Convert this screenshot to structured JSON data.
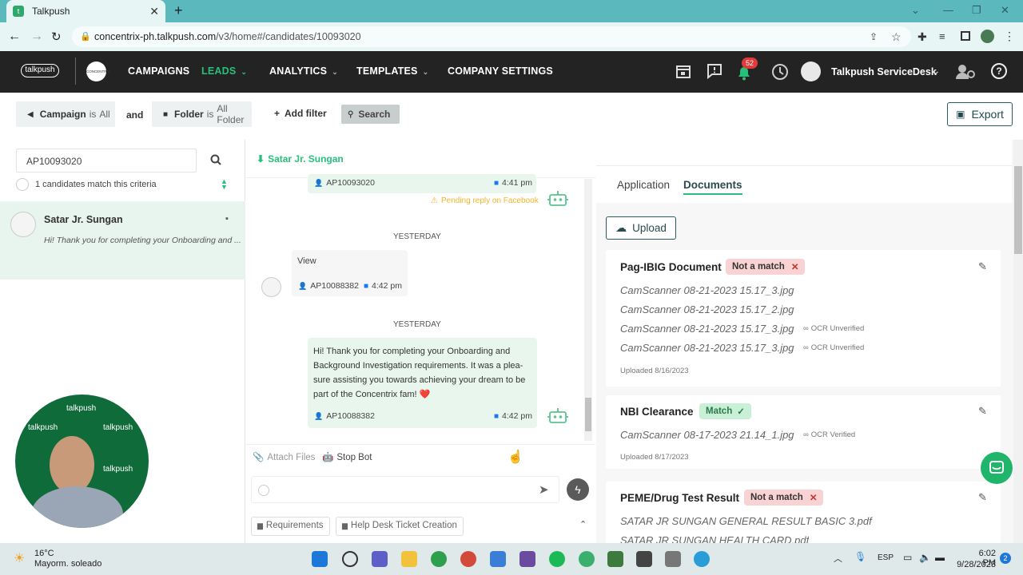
{
  "browser": {
    "tab_title": "Talkpush",
    "url_host": "concentrix-ph.talkpush.com",
    "url_path": "/v3/home#/candidates/10093020"
  },
  "header": {
    "logo_text": "talkpush",
    "client_logo": "CONCENTRIX",
    "nav": [
      "CAMPAIGNS",
      "LEADS",
      "ANALYTICS",
      "TEMPLATES",
      "COMPANY SETTINGS"
    ],
    "active_nav": "LEADS",
    "notif_count": "52",
    "user_name": "Talkpush ServiceDesk"
  },
  "filters": {
    "campaign_label": "Campaign",
    "campaign_op": "is",
    "campaign_value": "All",
    "and": "and",
    "folder_label": "Folder",
    "folder_op": "is",
    "folder_value": "All Folder",
    "add_filter": "Add filter",
    "search": "Search",
    "export": "Export"
  },
  "left": {
    "search_value": "AP10093020",
    "match_text": "1 candidates match this criteria",
    "candidate_name": "Satar Jr. Sungan",
    "candidate_preview": "Hi! Thank you for completing your Onboarding and ..."
  },
  "chat": {
    "header_name": "Satar Jr. Sungan",
    "msg1_id": "AP10093020",
    "msg1_time": "4:41 pm",
    "pending": "Pending reply on Facebook",
    "day1": "YESTERDAY",
    "msg2_text": "View",
    "msg2_id": "AP10088382",
    "msg2_time": "4:42 pm",
    "day2": "YESTERDAY",
    "msg3_line1": "Hi! Thank you for completing your Onboarding and",
    "msg3_line2": "Background Investigation requirements. It was a plea-",
    "msg3_line3": "sure assisting you towards achieving your dream to be",
    "msg3_line4": "part of the Concentrix fam! ❤️",
    "msg3_id": "AP10088382",
    "msg3_time": "4:42 pm",
    "attach": "Attach Files",
    "stop_bot": "Stop Bot",
    "requirements": "Requirements",
    "helpdesk": "Help Desk Ticket Creation"
  },
  "right": {
    "tabs": [
      "Application",
      "Documents"
    ],
    "active_tab": "Documents",
    "upload": "Upload",
    "docs": [
      {
        "title": "Pag-IBIG Document",
        "status": "Not a match",
        "files": [
          {
            "name": "CamScanner 08-21-2023 15.17_3.jpg",
            "ocr": ""
          },
          {
            "name": "CamScanner 08-21-2023 15.17_2.jpg",
            "ocr": ""
          },
          {
            "name": "CamScanner 08-21-2023 15.17_3.jpg",
            "ocr": "OCR Unverified"
          },
          {
            "name": "CamScanner 08-21-2023 15.17_3.jpg",
            "ocr": "OCR Unverified"
          }
        ],
        "uploaded": "Uploaded 8/16/2023"
      },
      {
        "title": "NBI Clearance",
        "status": "Match",
        "files": [
          {
            "name": "CamScanner 08-17-2023 21.14_1.jpg",
            "ocr": "OCR Verified"
          }
        ],
        "uploaded": "Uploaded 8/17/2023"
      },
      {
        "title": "PEME/Drug Test Result",
        "status": "Not a match",
        "files": [
          {
            "name": "SATAR JR SUNGAN   GENERAL RESULT BASIC 3.pdf",
            "ocr": ""
          },
          {
            "name": "SATAR JR SUNGAN   HEALTH CARD.pdf",
            "ocr": ""
          }
        ]
      }
    ]
  },
  "webcam": {
    "watermark": "talkpush"
  },
  "taskbar": {
    "temp": "16°C",
    "weather": "Mayorm. soleado",
    "lang": "ESP",
    "time": "6:02 PM",
    "date": "9/28/2023",
    "notif": "2"
  },
  "colors": {
    "accent": "#27c07a",
    "header_bg": "#232323",
    "chrome": "#5bb8bc",
    "badge_red": "#f9d3d3",
    "badge_green": "#c9efd7"
  }
}
